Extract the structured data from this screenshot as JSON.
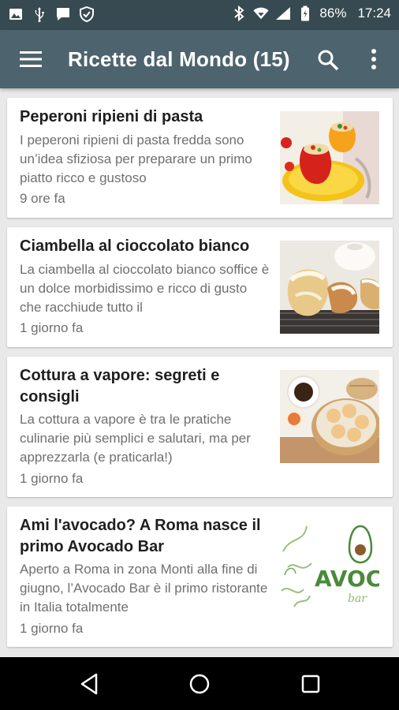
{
  "status_bar": {
    "battery": "86%",
    "time": "17:24",
    "icons": [
      "image-icon",
      "usb-icon",
      "message-icon",
      "shield-icon",
      "bluetooth-icon",
      "wifi-icon",
      "signal-icon",
      "battery-icon"
    ]
  },
  "app_bar": {
    "title": "Ricette dal Mondo (15)",
    "icons": [
      "menu-icon",
      "search-icon",
      "more-vert-icon"
    ]
  },
  "articles": [
    {
      "title": "Peperoni ripieni di pasta",
      "excerpt": "I peperoni ripieni di pasta fredda sono un’idea sfiziosa per preparare un primo piatto ricco e gustoso",
      "time": "9 ore fa",
      "thumbnail": "stuffed-peppers-image"
    },
    {
      "title": "Ciambella al cioccolato bianco",
      "excerpt": "La ciambella al cioccolato bianco soffice è un dolce morbidissimo e ricco di gusto che racchiude tutto il",
      "time": "1 giorno fa",
      "thumbnail": "white-chocolate-cake-image"
    },
    {
      "title": "Cottura a vapore: segreti e consigli",
      "excerpt": "La cottura a vapore è tra le pratiche culinarie più semplici e salutari, ma per apprezzarla (e praticarla!)",
      "time": "1 giorno fa",
      "thumbnail": "steamed-dumplings-image"
    },
    {
      "title": "Ami l'avocado? A Roma nasce il primo Avocado Bar",
      "excerpt": "Aperto a Roma in zona Monti alla fine di giugno, l’Avocado Bar è il primo ristorante in Italia totalmente",
      "time": "1 giorno fa",
      "thumbnail": "avocado-bar-logo-image",
      "thumbnail_text": "AVOCADO",
      "thumbnail_subtext": "bar"
    }
  ],
  "nav_bar": {
    "icons": [
      "back-icon",
      "home-icon",
      "recents-icon"
    ]
  },
  "colors": {
    "status_bar": "#374a52",
    "app_bar": "#4d636e",
    "background": "#e9e9e9",
    "card": "#ffffff",
    "title_text": "#1f1f1f",
    "secondary_text": "#6f6f6f",
    "avocado_green": "#4a8a3a"
  }
}
